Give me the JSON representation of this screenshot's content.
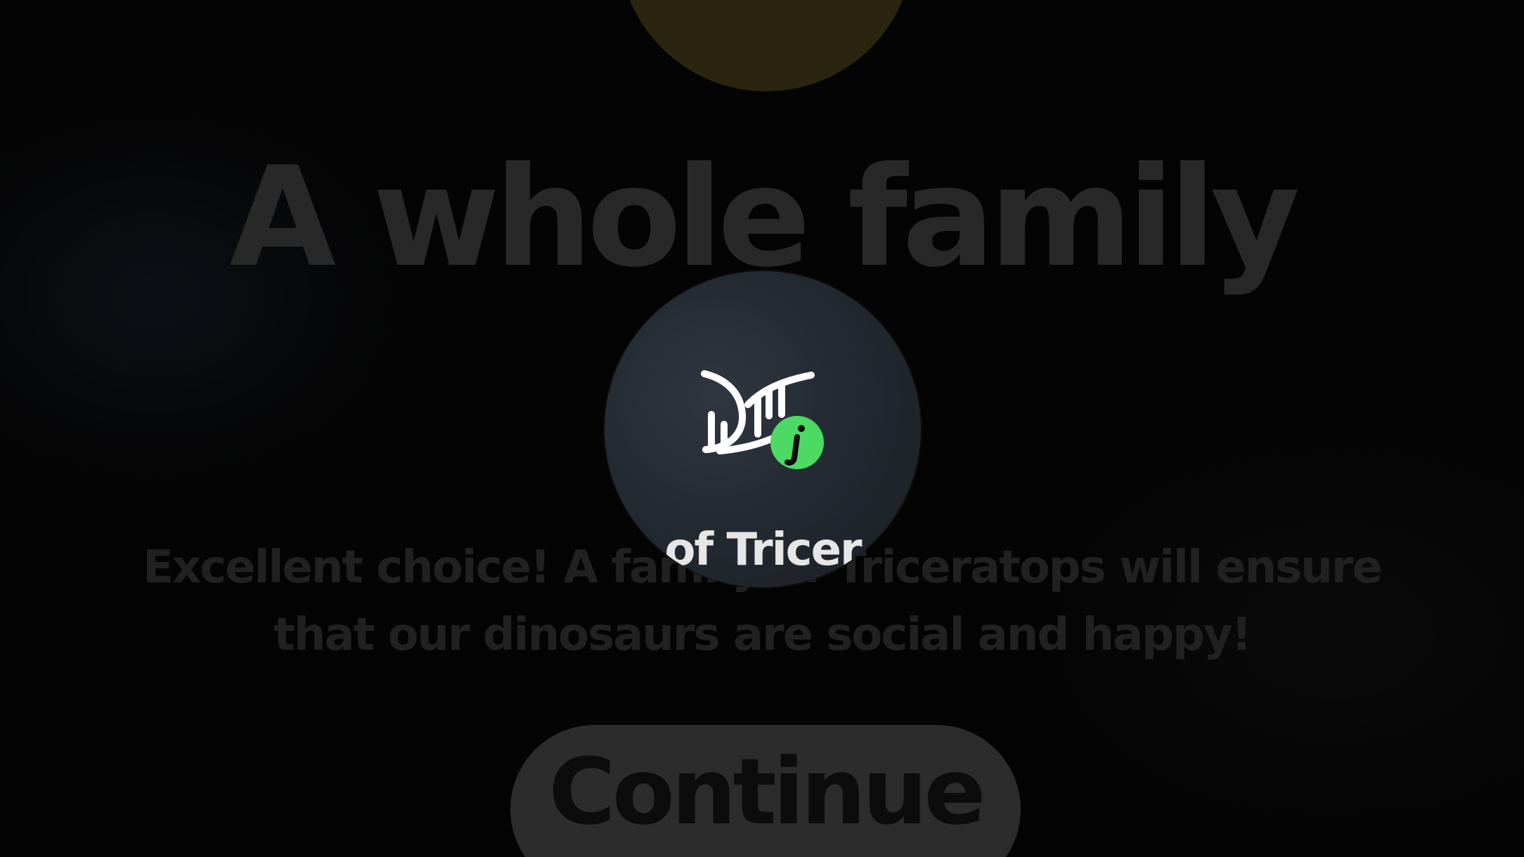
{
  "screen": {
    "headline": "A whole family",
    "subtitle": "Excellent choice! A family of Triceratops will ensure that our dinosaurs are social and happy!",
    "continue_label": "Continue"
  },
  "loading_overlay": {
    "caption": "of Tricer",
    "logo_icon": "dino-app-logo-icon",
    "badge_icon": "info-badge-icon",
    "badge_color": "#4cd964"
  },
  "colors": {
    "background": "#060606",
    "headline": "#363636",
    "subtitle": "#2d2d2d",
    "button": "#3b3b3b",
    "top_circle": "#3a3214"
  }
}
